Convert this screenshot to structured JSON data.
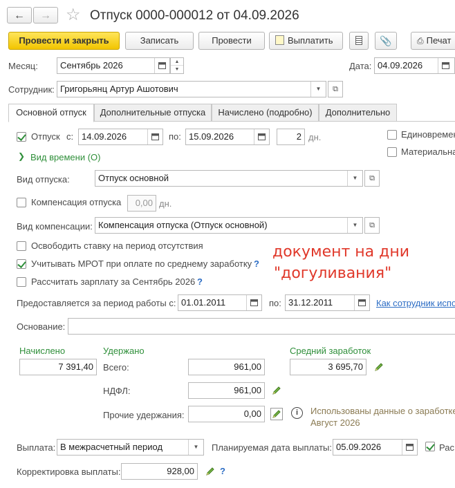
{
  "header": {
    "title": "Отпуск 0000-000012 от 04.09.2026"
  },
  "toolbar": {
    "post_close": "Провести и закрыть",
    "save": "Записать",
    "post": "Провести",
    "pay": "Выплатить",
    "print": "Печат"
  },
  "top": {
    "month_label": "Месяц:",
    "month_value": "Сентябрь 2026",
    "date_label": "Дата:",
    "date_value": "04.09.2026",
    "employee_label": "Сотрудник:",
    "employee_value": "Григорьянц Артур Ашотович"
  },
  "tabs": [
    "Основной отпуск",
    "Дополнительные отпуска",
    "Начислено (подробно)",
    "Дополнительно"
  ],
  "leave": {
    "label": "Отпуск",
    "from_label": "с:",
    "from": "14.09.2026",
    "to_label": "по:",
    "to": "15.09.2026",
    "days": "2",
    "days_unit": "дн.",
    "one_time": "Единовремен",
    "material": "Материальна",
    "time_kind": "Вид времени (О)"
  },
  "kind": {
    "label": "Вид отпуска:",
    "value": "Отпуск основной"
  },
  "compensation": {
    "label": "Компенсация отпуска",
    "days": "0,00",
    "unit": "дн.",
    "kind_label": "Вид компенсации:",
    "kind_value": "Компенсация отпуска (Отпуск основной)"
  },
  "options": {
    "free_rate": "Освободить ставку на период отсутствия",
    "mrot": "Учитывать МРОТ при оплате по среднему заработку",
    "calc_salary": "Рассчитать зарплату за Сентябрь 2026"
  },
  "annotation": {
    "line1": "документ на дни",
    "line2": "\"догуливания\""
  },
  "period": {
    "label": "Предоставляется за период работы с:",
    "from": "01.01.2011",
    "to_label": "по:",
    "to": "31.12.2011",
    "link": "Как сотрудник испо"
  },
  "basis": {
    "label": "Основание:",
    "value": ""
  },
  "amounts": {
    "accrued_label": "Начислено",
    "accrued": "7 391,40",
    "withheld_label": "Удержано",
    "total_label": "Всего:",
    "total": "961,00",
    "ndfl_label": "НДФЛ:",
    "ndfl": "961,00",
    "other_label": "Прочие удержания:",
    "other": "0,00",
    "avg_label": "Средний заработок",
    "avg": "3 695,70",
    "info_line1": "Использованы данные о заработке",
    "info_line2": "Август 2026"
  },
  "payout": {
    "label": "Выплата:",
    "value": "В межрасчетный период",
    "planned_label": "Планируемая дата выплаты:",
    "planned_date": "05.09.2026",
    "calc_label": "Рас",
    "adjust_label": "Корректировка выплаты:",
    "adjust_value": "928,00"
  },
  "colors": {
    "primary_button": "#f2c500",
    "accent_green": "#2f8f3a",
    "link_blue": "#2b6cc4",
    "annotation_red": "#e0382a"
  }
}
